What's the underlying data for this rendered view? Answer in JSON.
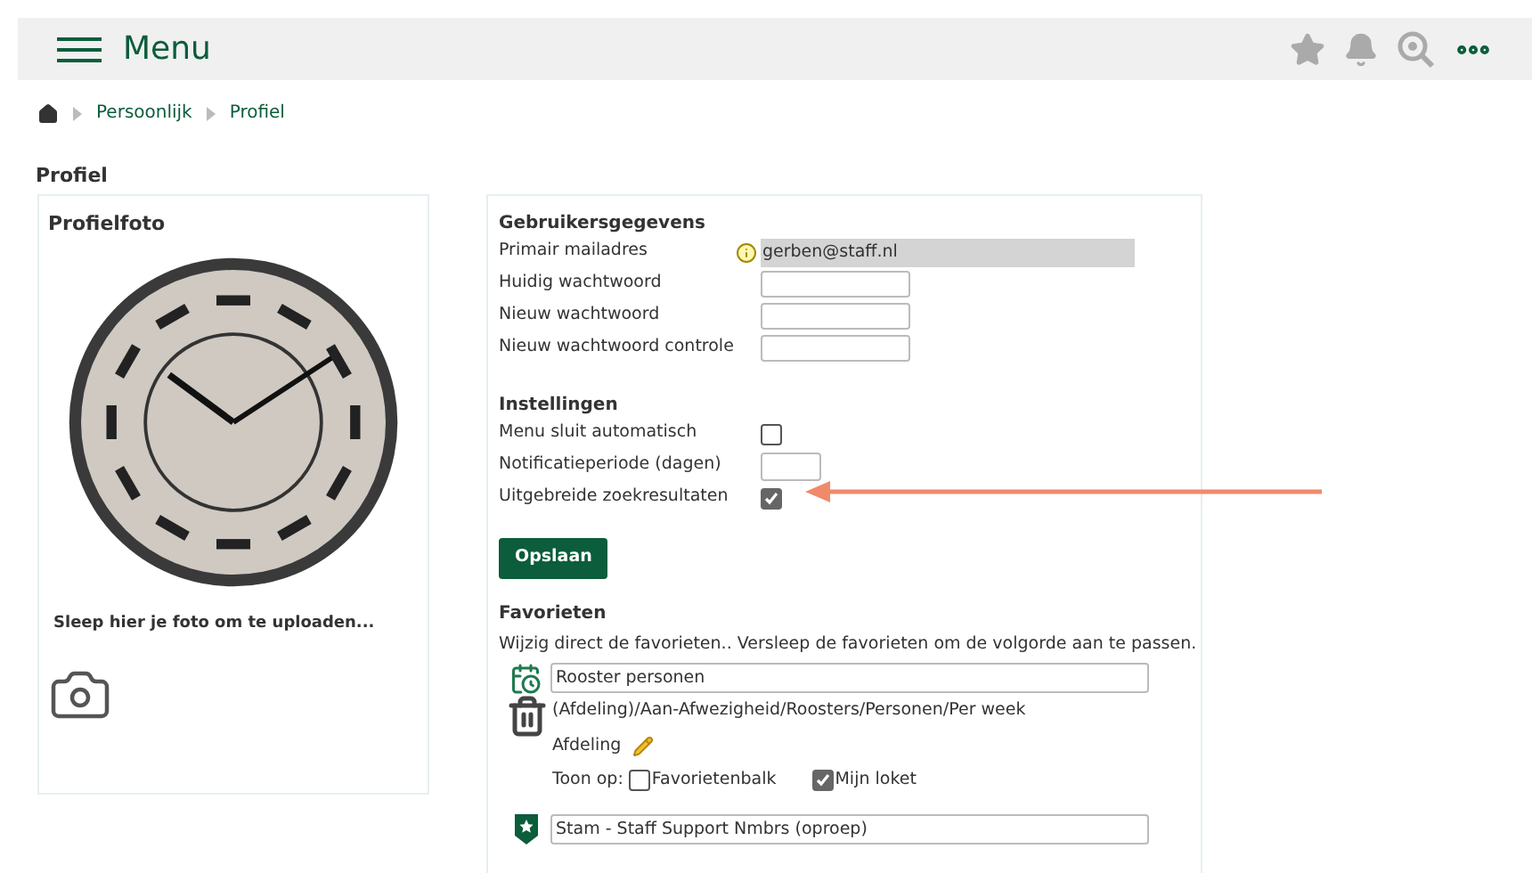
{
  "header": {
    "menu_label": "Menu"
  },
  "breadcrumb": [
    "Persoonlijk",
    "Profiel"
  ],
  "page_title": "Profiel",
  "photo_card": {
    "title": "Profielfoto",
    "upload_hint": "Sleep hier je foto om te uploaden..."
  },
  "user_data": {
    "title": "Gebruikersgegevens",
    "fields": [
      {
        "label": "Primair mailadres",
        "kind": "readonly",
        "value": "gerben@staff.nl"
      },
      {
        "label": "Huidig wachtwoord",
        "kind": "input"
      },
      {
        "label": "Nieuw wachtwoord",
        "kind": "input"
      },
      {
        "label": "Nieuw wachtwoord controle",
        "kind": "input"
      }
    ]
  },
  "settings": {
    "title": "Instellingen",
    "items": [
      {
        "label": "Menu sluit automatisch",
        "kind": "checkbox",
        "checked": false
      },
      {
        "label": "Notificatieperiode (dagen)",
        "kind": "number"
      },
      {
        "label": "Uitgebreide zoekresultaten",
        "kind": "checkbox",
        "checked": true
      }
    ]
  },
  "save_button": "Opslaan",
  "favorites": {
    "title": "Favorieten",
    "hint": "Wijzig direct de favorieten.. Versleep de favorieten om de volgorde aan te passen.",
    "items": [
      {
        "kind": "calendar",
        "name": "Rooster personen",
        "path": "(Afdeling)/Aan-Afwezigheid/Roosters/Personen/Per week",
        "scope": "Afdeling",
        "show_on_label": "Toon op:",
        "options": [
          {
            "label": "Favorietenbalk",
            "checked": false
          },
          {
            "label": "Mijn loket",
            "checked": true
          }
        ]
      },
      {
        "kind": "shield",
        "name": "Stam - Staff Support Nmbrs (oproep)"
      }
    ]
  }
}
